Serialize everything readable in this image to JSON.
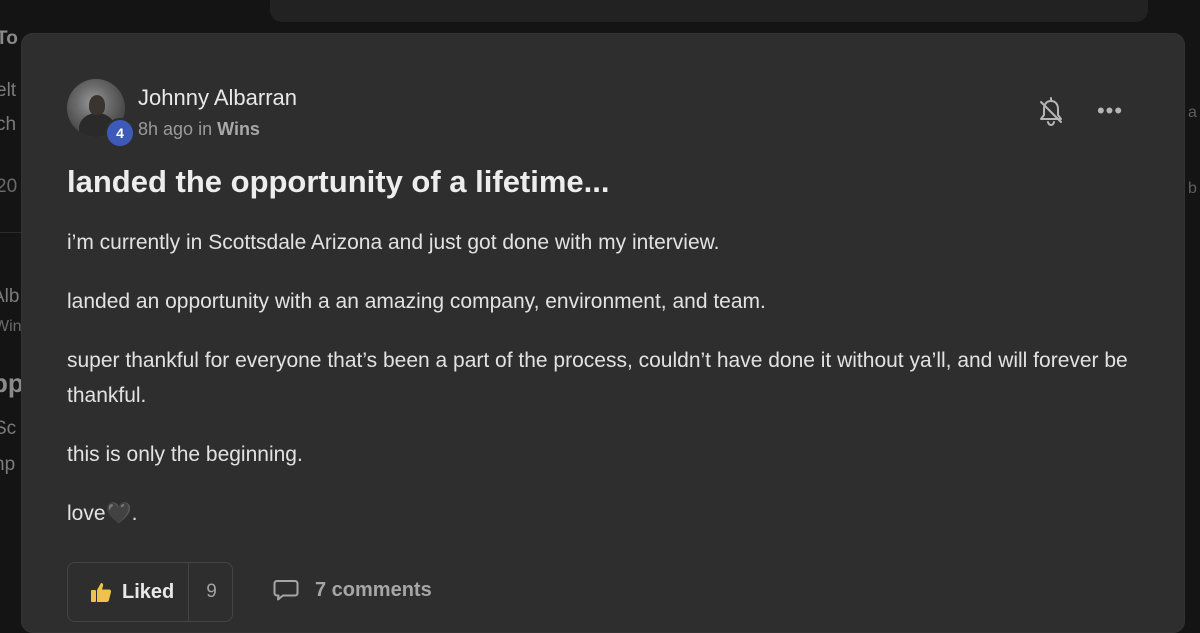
{
  "background": {
    "fragments": [
      "To",
      "elt",
      "ch",
      "20",
      "Alb",
      "Win",
      "pp",
      "Sc",
      "np",
      "a",
      "b"
    ]
  },
  "post": {
    "author": {
      "name": "Johnny Albarran",
      "level": "4"
    },
    "meta": {
      "time": "8h ago",
      "in": "in",
      "category": "Wins"
    },
    "title": "landed the opportunity of a lifetime...",
    "body": [
      "i’m currently in Scottsdale Arizona and just got done with my interview.",
      "landed an opportunity with a an amazing company, environment, and team.",
      "super thankful for everyone that’s been a part of the process, couldn’t have done it without ya’ll, and will forever be thankful.",
      "this is only the beginning.",
      "love🖤."
    ],
    "actions": {
      "liked_label": "Liked",
      "like_count": "9",
      "comments_label": "7 comments"
    }
  },
  "icons": {
    "bell": "bell-off-icon",
    "more": "more-horizontal-icon",
    "thumb": "thumbs-up-icon",
    "comment": "comment-icon"
  },
  "colors": {
    "card": "#2e2e2e",
    "page": "#141414",
    "level_badge": "#3d5ab8",
    "thumb": "#f0c24a"
  }
}
